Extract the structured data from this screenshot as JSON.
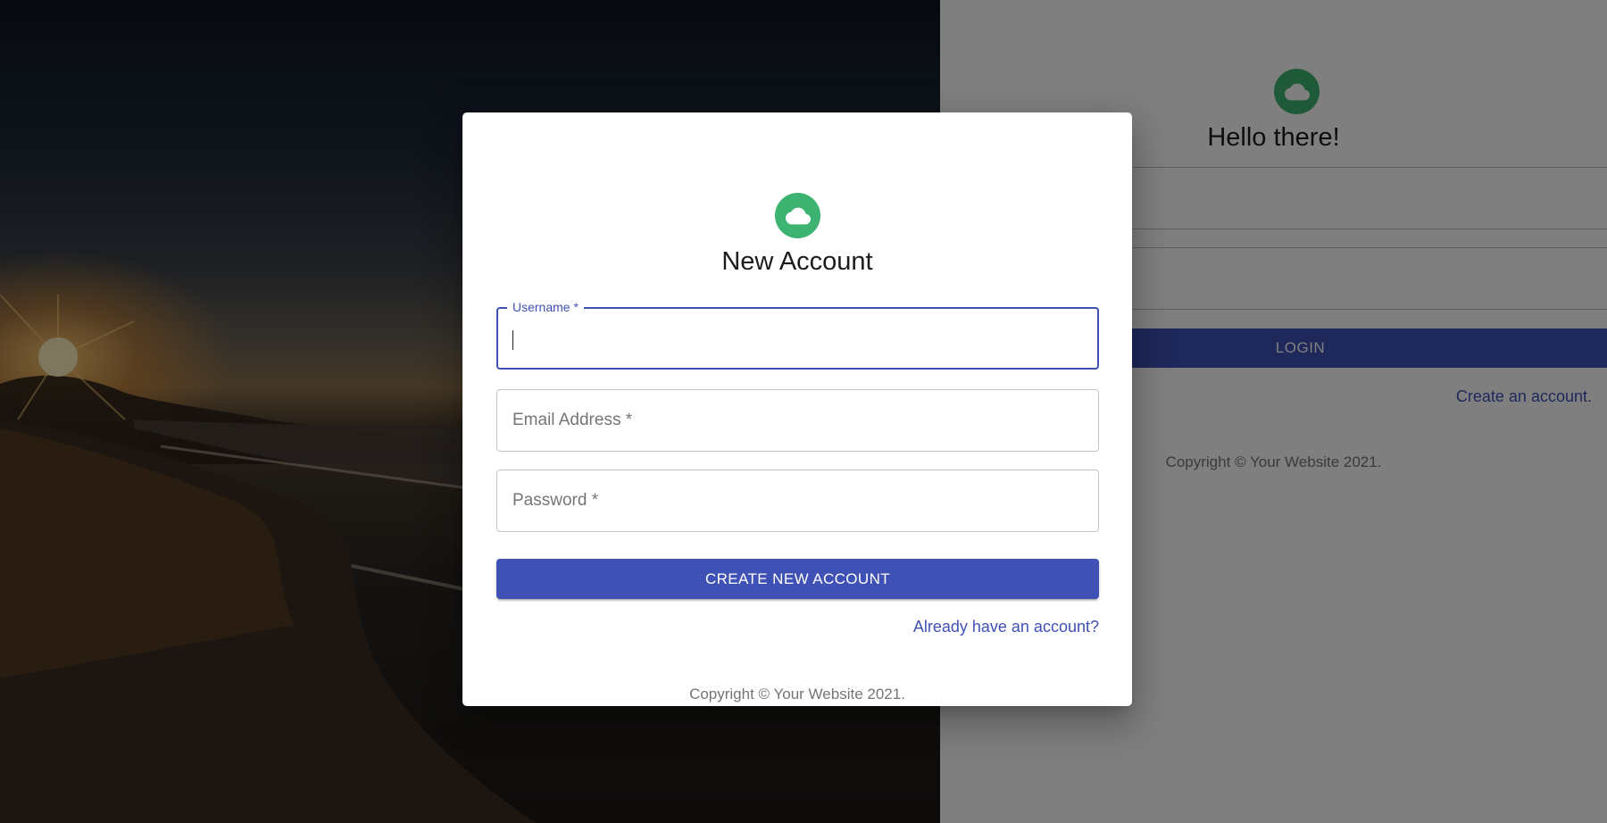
{
  "login": {
    "title": "Hello there!",
    "button_label": "LOGIN",
    "create_link": "Create an account.",
    "copyright": "Copyright © Your Website 2021."
  },
  "dialog": {
    "title": "New Account",
    "username": {
      "label": "Username *",
      "value": ""
    },
    "email": {
      "placeholder": "Email Address *",
      "value": ""
    },
    "password": {
      "placeholder": "Password *",
      "value": ""
    },
    "submit_label": "CREATE NEW ACCOUNT",
    "signin_link": "Already have an account?",
    "copyright": "Copyright © Your Website 2021."
  },
  "icons": {
    "logo": "cloud-icon"
  },
  "colors": {
    "primary": "#3f51b5",
    "avatar": "#3cb371",
    "backdrop": "rgba(0,0,0,0.5)"
  }
}
